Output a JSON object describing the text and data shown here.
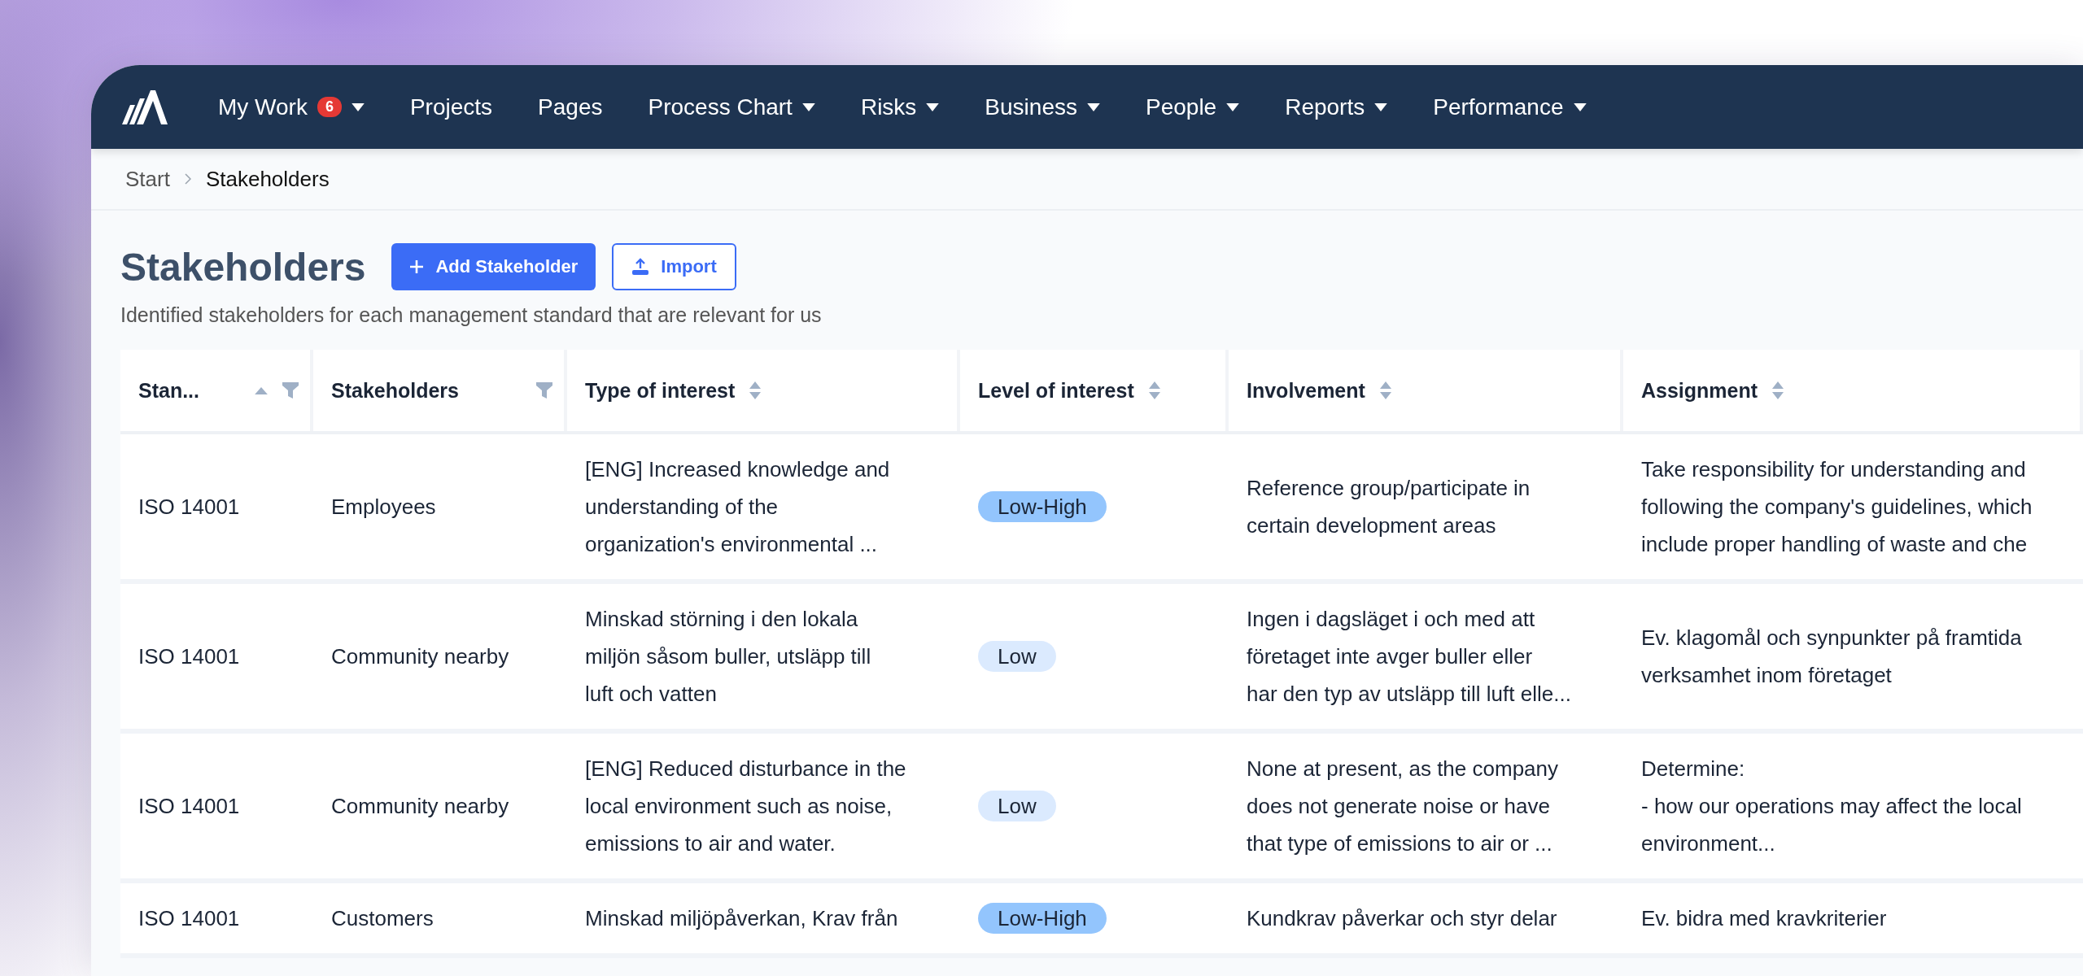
{
  "nav": {
    "items": [
      {
        "label": "My Work",
        "badge": "6",
        "dropdown": true
      },
      {
        "label": "Projects",
        "dropdown": false
      },
      {
        "label": "Pages",
        "dropdown": false
      },
      {
        "label": "Process Chart",
        "dropdown": true
      },
      {
        "label": "Risks",
        "dropdown": true
      },
      {
        "label": "Business",
        "dropdown": true
      },
      {
        "label": "People",
        "dropdown": true
      },
      {
        "label": "Reports",
        "dropdown": true
      },
      {
        "label": "Performance",
        "dropdown": true
      }
    ]
  },
  "breadcrumb": [
    "Start",
    "Stakeholders"
  ],
  "page": {
    "title": "Stakeholders",
    "buttons": [
      {
        "label": "Add Stakeholder",
        "kind": "primary"
      },
      {
        "label": "Import",
        "kind": "outline"
      }
    ],
    "subtitle": "Identified stakeholders for each management standard that are relevant for us"
  },
  "table": {
    "columns": [
      {
        "label": "Stan...",
        "sortable": true,
        "sorted_ascending": true,
        "filter": true
      },
      {
        "label": "Stakeholders",
        "sortable": false,
        "sorted_ascending": false,
        "filter": true
      },
      {
        "label": "Type of interest",
        "sortable": true,
        "sorted_ascending": false,
        "filter": false
      },
      {
        "label": "Level of interest",
        "sortable": true,
        "sorted_ascending": false,
        "filter": false
      },
      {
        "label": "Involvement",
        "sortable": true,
        "sorted_ascending": false,
        "filter": false
      },
      {
        "label": "Assignment",
        "sortable": true,
        "sorted_ascending": false,
        "filter": false
      }
    ],
    "rows": [
      {
        "standard": "ISO 14001",
        "stakeholder": "Employees",
        "type_of_interest": "[ENG] Increased knowledge and\nunderstanding of the\norganization's environmental ...",
        "level": {
          "text": "Low-High",
          "color": "#93c5fd"
        },
        "involvement": "Reference group/participate in\ncertain development areas",
        "assignment": "Take responsibility for understanding and\nfollowing the company's guidelines, which\ninclude proper handling of waste and che"
      },
      {
        "standard": "ISO 14001",
        "stakeholder": "Community nearby",
        "type_of_interest": "Minskad störning i den lokala\nmiljön såsom buller, utsläpp till\nluft och vatten",
        "level": {
          "text": "Low",
          "color": "#dbeafe"
        },
        "involvement": "Ingen i dagsläget i och med att\nföretaget inte avger buller eller\nhar den typ av utsläpp till luft elle...",
        "assignment": "Ev. klagomål och synpunkter på framtida\nverksamhet inom företaget"
      },
      {
        "standard": "ISO 14001",
        "stakeholder": "Community nearby",
        "type_of_interest": "[ENG] Reduced disturbance in the\nlocal environment such as noise,\nemissions to air and water.",
        "level": {
          "text": "Low",
          "color": "#dbeafe"
        },
        "involvement": "None at present, as the company\ndoes not generate noise or have\nthat type of emissions to air or ...",
        "assignment": "Determine:\n- how our operations may affect the local\nenvironment..."
      },
      {
        "standard": "ISO 14001",
        "stakeholder": "Customers",
        "type_of_interest": "Minskad miljöpåverkan, Krav från",
        "level": {
          "text": "Low-High",
          "color": "#93c5fd"
        },
        "involvement": "Kundkrav påverkar och styr delar",
        "assignment": "Ev. bidra med kravkriterier"
      }
    ]
  }
}
